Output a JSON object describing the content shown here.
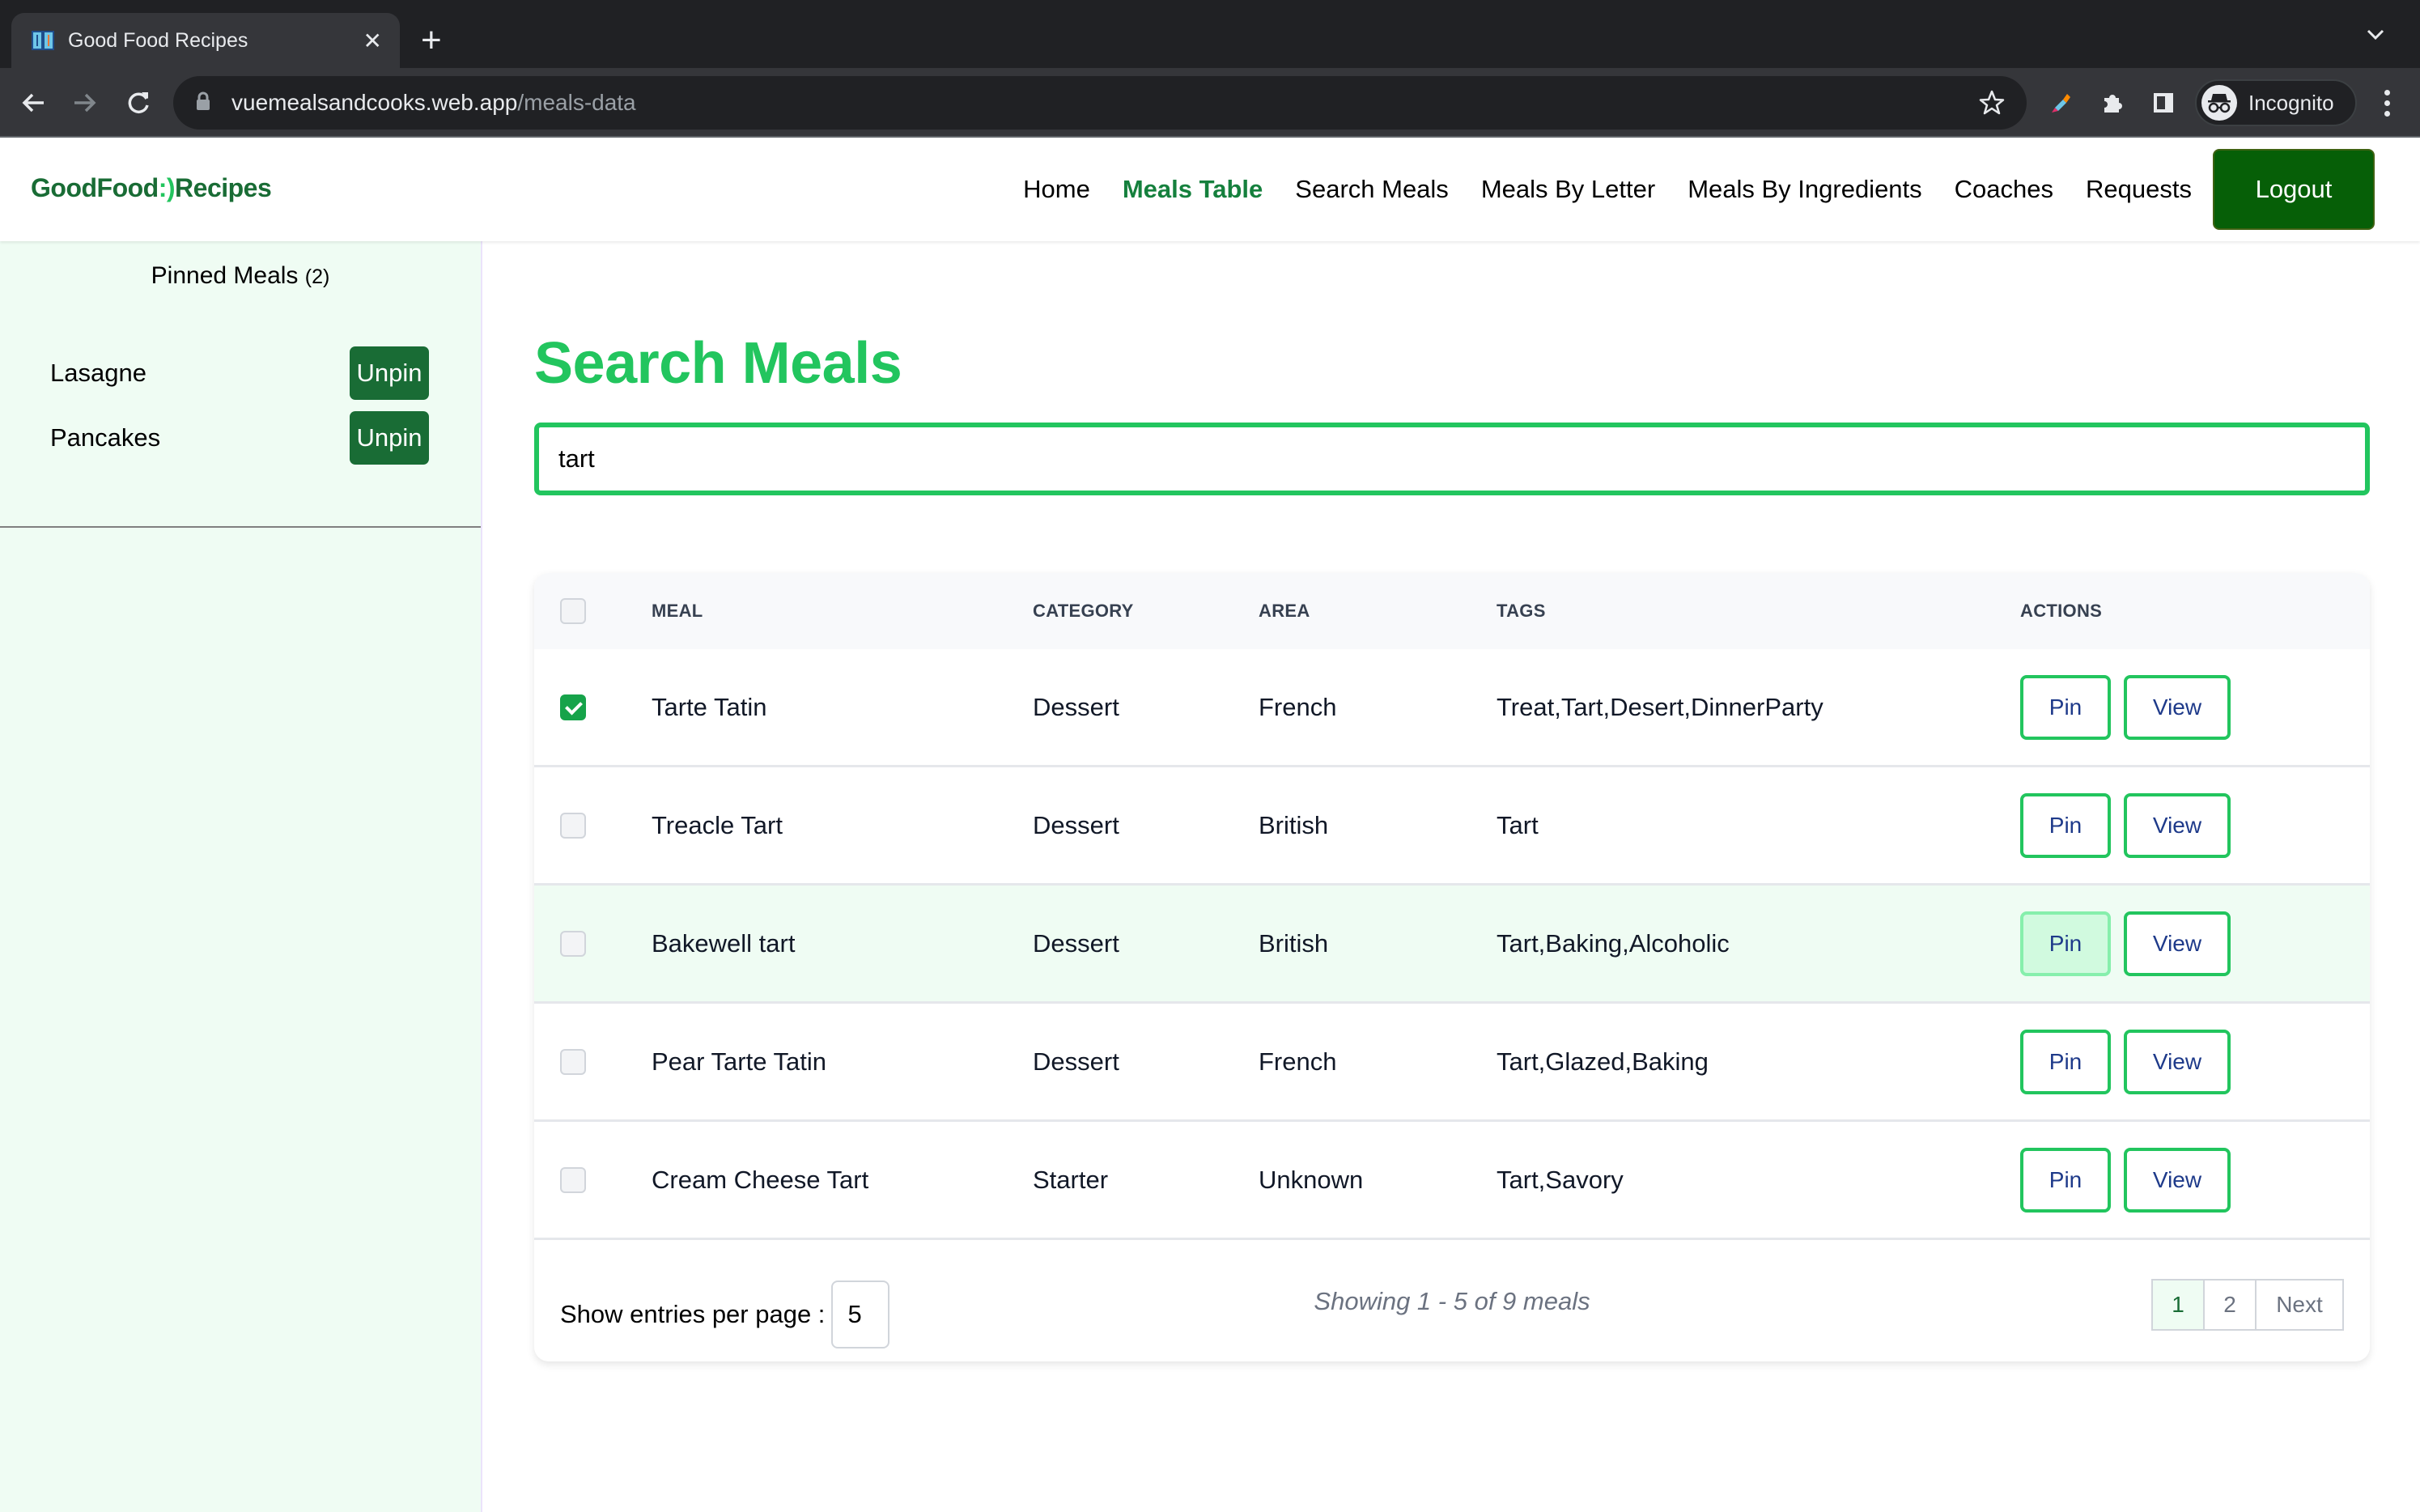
{
  "browser": {
    "tab_title": "Good Food Recipes",
    "url_host": "vuemealsandcooks.web.app",
    "url_path": "/meals-data",
    "profile_label": "Incognito",
    "icons": {
      "favicon": "recipe-book-icon",
      "close": "close-icon",
      "new_tab": "plus-icon",
      "tab_menu": "chevron-down-icon",
      "back": "arrow-left-icon",
      "forward": "arrow-right-icon",
      "reload": "reload-icon",
      "lock": "lock-icon",
      "bookmark": "star-icon",
      "eyedropper": "eyedropper-icon",
      "extensions": "puzzle-icon",
      "side_panel": "side-panel-icon",
      "incognito": "incognito-icon",
      "menu": "kebab-menu-icon"
    }
  },
  "navbar": {
    "logo": {
      "part1": "GoodFood",
      "smile": ":)",
      "part2": "Recipes"
    },
    "links": [
      {
        "label": "Home",
        "active": false
      },
      {
        "label": "Meals Table",
        "active": true
      },
      {
        "label": "Search Meals",
        "active": false
      },
      {
        "label": "Meals By Letter",
        "active": false
      },
      {
        "label": "Meals By Ingredients",
        "active": false
      },
      {
        "label": "Coaches",
        "active": false
      },
      {
        "label": "Requests",
        "active": false
      }
    ],
    "logout_label": "Logout"
  },
  "sidebar": {
    "title": "Pinned Meals",
    "count": "(2)",
    "items": [
      {
        "name": "Lasagne",
        "action": "Unpin"
      },
      {
        "name": "Pancakes",
        "action": "Unpin"
      }
    ]
  },
  "main": {
    "title": "Search Meals",
    "search_value": "tart",
    "table": {
      "headers": [
        "MEAL",
        "CATEGORY",
        "AREA",
        "TAGS",
        "ACTIONS"
      ],
      "select_all_checked": false,
      "rows": [
        {
          "checked": true,
          "meal": "Tarte Tatin",
          "category": "Dessert",
          "area": "French",
          "tags": "Treat,Tart,Desert,DinnerParty",
          "pin": "Pin",
          "view": "View"
        },
        {
          "checked": false,
          "meal": "Treacle Tart",
          "category": "Dessert",
          "area": "British",
          "tags": "Tart",
          "pin": "Pin",
          "view": "View"
        },
        {
          "checked": false,
          "meal": "Bakewell tart",
          "category": "Dessert",
          "area": "British",
          "tags": "Tart,Baking,Alcoholic",
          "pin": "Pin",
          "view": "View"
        },
        {
          "checked": false,
          "meal": "Pear Tarte Tatin",
          "category": "Dessert",
          "area": "French",
          "tags": "Tart,Glazed,Baking",
          "pin": "Pin",
          "view": "View"
        },
        {
          "checked": false,
          "meal": "Cream Cheese Tart",
          "category": "Starter",
          "area": "Unknown",
          "tags": "Tart,Savory",
          "pin": "Pin",
          "view": "View"
        }
      ]
    },
    "footer": {
      "entries_label": "Show entries per page :",
      "entries_value": "5",
      "showing_text": "Showing 1 - 5 of 9 meals",
      "pages": [
        "1",
        "2"
      ],
      "current_page": "1",
      "next_label": "Next"
    }
  },
  "colors": {
    "brand_dark_green": "#196c35",
    "accent_green": "#22c55e",
    "active_nav": "#15803d",
    "logout_bg": "#065f07",
    "sidebar_bg": "#effcf3",
    "action_text": "#1e3a8a"
  }
}
